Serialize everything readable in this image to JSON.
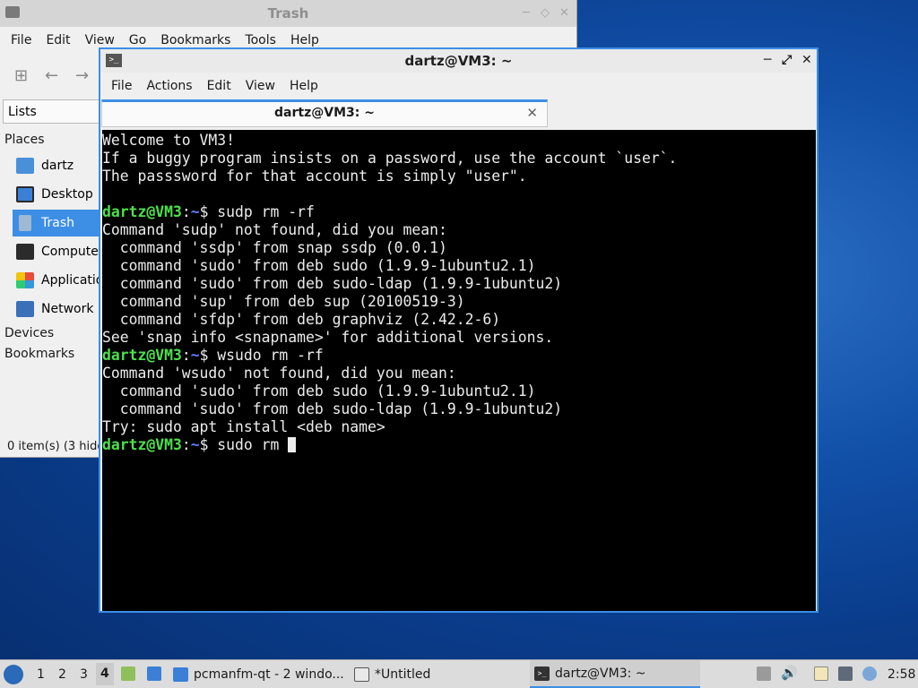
{
  "file_manager": {
    "title": "Trash",
    "menu": [
      "File",
      "Edit",
      "View",
      "Go",
      "Bookmarks",
      "Tools",
      "Help"
    ],
    "side_pane_mode": "Lists",
    "places_header": "Places",
    "places": [
      {
        "label": "dartz",
        "icon": "home-folder-icon",
        "selected": false
      },
      {
        "label": "Desktop",
        "icon": "desktop-icon",
        "selected": false
      },
      {
        "label": "Trash",
        "icon": "trash-icon",
        "selected": true
      },
      {
        "label": "Compute",
        "icon": "computer-icon",
        "selected": false
      },
      {
        "label": "Applicatio",
        "icon": "applications-icon",
        "selected": false
      },
      {
        "label": "Network",
        "icon": "network-icon",
        "selected": false
      }
    ],
    "devices_header": "Devices",
    "bookmarks_header": "Bookmarks",
    "status": "0 item(s) (3 hidd"
  },
  "terminal": {
    "title": "dartz@VM3: ~",
    "menu": [
      "File",
      "Actions",
      "Edit",
      "View",
      "Help"
    ],
    "tab_label": "dartz@VM3: ~",
    "lines": [
      {
        "text": "Welcome to VM3!"
      },
      {
        "text": "If a buggy program insists on a password, use the account `user`."
      },
      {
        "text": "The passsword for that account is simply \"user\"."
      },
      {
        "text": ""
      },
      {
        "prompt_user": "dartz@VM3",
        "prompt_path": "~",
        "text": "$ sudp rm -rf"
      },
      {
        "text": "Command 'sudp' not found, did you mean:"
      },
      {
        "text": "  command 'ssdp' from snap ssdp (0.0.1)"
      },
      {
        "text": "  command 'sudo' from deb sudo (1.9.9-1ubuntu2.1)"
      },
      {
        "text": "  command 'sudo' from deb sudo-ldap (1.9.9-1ubuntu2)"
      },
      {
        "text": "  command 'sup' from deb sup (20100519-3)"
      },
      {
        "text": "  command 'sfdp' from deb graphviz (2.42.2-6)"
      },
      {
        "text": "See 'snap info <snapname>' for additional versions."
      },
      {
        "prompt_user": "dartz@VM3",
        "prompt_path": "~",
        "text": "$ wsudo rm -rf"
      },
      {
        "text": "Command 'wsudo' not found, did you mean:"
      },
      {
        "text": "  command 'sudo' from deb sudo (1.9.9-1ubuntu2.1)"
      },
      {
        "text": "  command 'sudo' from deb sudo-ldap (1.9.9-1ubuntu2)"
      },
      {
        "text": "Try: sudo apt install <deb name>"
      },
      {
        "prompt_user": "dartz@VM3",
        "prompt_path": "~",
        "text": "$ sudo rm ",
        "cursor": true
      }
    ]
  },
  "taskbar": {
    "workspaces": [
      "1",
      "2",
      "3",
      "4"
    ],
    "active_workspace": "4",
    "tasks": [
      {
        "label": "pcmanfm-qt - 2 windo...",
        "icon": "folder-icon"
      },
      {
        "label": "*Untitled",
        "icon": "text-editor-icon"
      },
      {
        "label": "dartz@VM3: ~",
        "icon": "terminal-icon",
        "active": true
      }
    ],
    "clock": "2:58"
  },
  "colors": {
    "accent": "#3d8ee5",
    "prompt_user": "#4de14d",
    "prompt_path": "#5f7fff"
  }
}
